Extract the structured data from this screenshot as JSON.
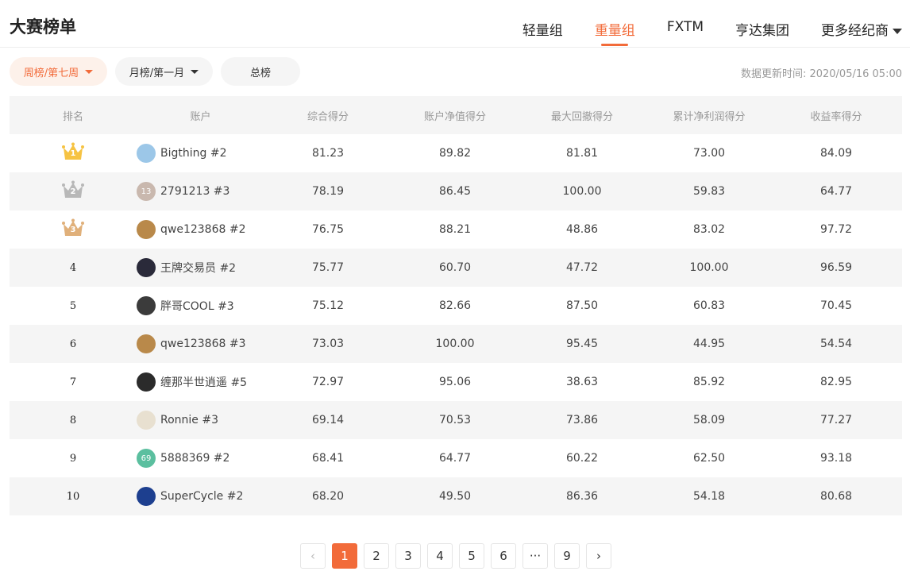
{
  "header": {
    "title": "大赛榜单",
    "tabs": [
      {
        "label": "轻量组",
        "active": false
      },
      {
        "label": "重量组",
        "active": true
      },
      {
        "label": "FXTM",
        "active": false
      },
      {
        "label": "亨达集团",
        "active": false
      },
      {
        "label": "更多经纪商",
        "active": false,
        "dropdown": true
      }
    ]
  },
  "filters": {
    "week": "周榜/第七周",
    "month": "月榜/第一月",
    "total": "总榜",
    "update_time": "数据更新时间: 2020/05/16 05:00"
  },
  "table": {
    "columns": [
      "排名",
      "账户",
      "综合得分",
      "账户净值得分",
      "最大回撤得分",
      "累计净利润得分",
      "收益率得分"
    ],
    "rows": [
      {
        "rank": "1",
        "account": "Bigthing #2",
        "avatar": "user-avatar",
        "composite": "81.23",
        "equity": "89.82",
        "drawdown": "81.81",
        "profit": "73.00",
        "return": "84.09"
      },
      {
        "rank": "2",
        "account": "2791213 #3",
        "avatar": "13",
        "composite": "78.19",
        "equity": "86.45",
        "drawdown": "100.00",
        "profit": "59.83",
        "return": "64.77"
      },
      {
        "rank": "3",
        "account": "qwe123868 #2",
        "avatar": "user-avatar",
        "composite": "76.75",
        "equity": "88.21",
        "drawdown": "48.86",
        "profit": "83.02",
        "return": "97.72"
      },
      {
        "rank": "4",
        "account": "王牌交易员 #2",
        "avatar": "user-avatar",
        "composite": "75.77",
        "equity": "60.70",
        "drawdown": "47.72",
        "profit": "100.00",
        "return": "96.59"
      },
      {
        "rank": "5",
        "account": "胖哥COOL #3",
        "avatar": "user-avatar",
        "composite": "75.12",
        "equity": "82.66",
        "drawdown": "87.50",
        "profit": "60.83",
        "return": "70.45"
      },
      {
        "rank": "6",
        "account": "qwe123868 #3",
        "avatar": "user-avatar",
        "composite": "73.03",
        "equity": "100.00",
        "drawdown": "95.45",
        "profit": "44.95",
        "return": "54.54"
      },
      {
        "rank": "7",
        "account": "缠那半世逍遥 #5",
        "avatar": "user-avatar",
        "composite": "72.97",
        "equity": "95.06",
        "drawdown": "38.63",
        "profit": "85.92",
        "return": "82.95"
      },
      {
        "rank": "8",
        "account": "Ronnie #3",
        "avatar": "user-avatar",
        "composite": "69.14",
        "equity": "70.53",
        "drawdown": "73.86",
        "profit": "58.09",
        "return": "77.27"
      },
      {
        "rank": "9",
        "account": "5888369 #2",
        "avatar": "69",
        "composite": "68.41",
        "equity": "64.77",
        "drawdown": "60.22",
        "profit": "62.50",
        "return": "93.18"
      },
      {
        "rank": "10",
        "account": "SuperCycle #2",
        "avatar": "user-avatar",
        "composite": "68.20",
        "equity": "49.50",
        "drawdown": "86.36",
        "profit": "54.18",
        "return": "80.68"
      }
    ]
  },
  "avatar_colors": [
    "#9cc7e8",
    "#c9b8ae",
    "#b9894a",
    "#2a2a3a",
    "#3b3b3b",
    "#b9894a",
    "#2b2b2b",
    "#e8e0d0",
    "#5bbf9f",
    "#1d3f8f"
  ],
  "crown_colors": [
    "#f6c343",
    "#b8b8b8",
    "#e0b07a"
  ],
  "accent_color": "#f26b3a",
  "pagination": {
    "prev": "‹",
    "pages": [
      "1",
      "2",
      "3",
      "4",
      "5",
      "6"
    ],
    "ellipsis": "···",
    "last": "9",
    "next": "›",
    "current": "1"
  }
}
